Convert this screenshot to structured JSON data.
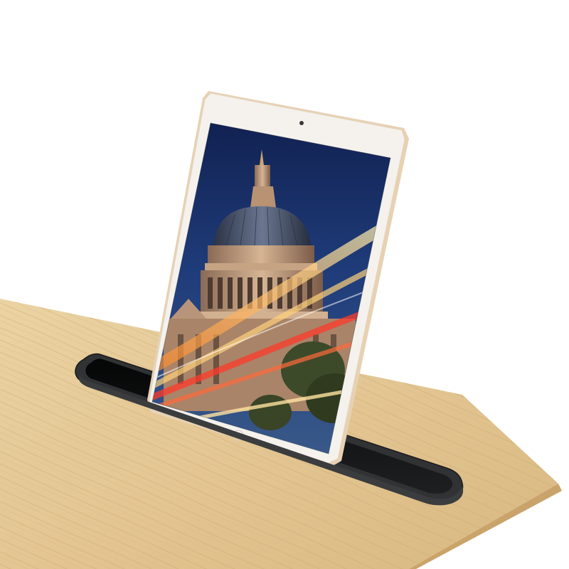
{
  "scene": {
    "subject": "tablet-in-desk-slot",
    "colors": {
      "background": "#ffffff",
      "wood_light": "#e8cf9c",
      "wood_dark": "#d2b078",
      "wood_edge": "#caa56a",
      "slot_frame": "#2e2f31",
      "slot_inner": "#0e0f10",
      "tablet_bezel": "#f4f1ec",
      "tablet_frame_gold": "#e6cfb0",
      "sky_top": "#10204f",
      "sky_bottom": "#3a5a8a",
      "dome": "#4a5670",
      "stone": "#c9a888",
      "light_trail_gold": "#ffcf6a",
      "light_trail_red": "#ff3a2a"
    },
    "icons": {
      "camera": "front-camera-dot",
      "home": "home-button"
    }
  }
}
